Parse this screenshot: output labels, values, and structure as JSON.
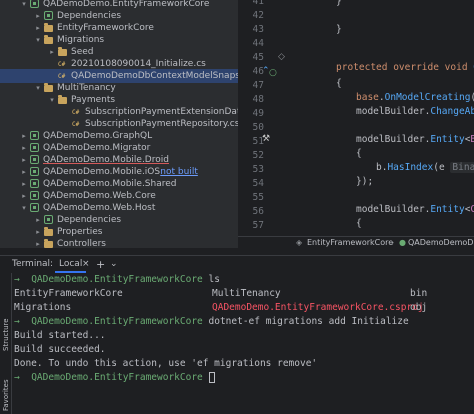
{
  "tree": {
    "rows": [
      {
        "label": "QADemoDemo.EntityFrameworkCore",
        "icon": "project-icon",
        "arrow": "▾",
        "indent": 30,
        "style": ""
      },
      {
        "label": "Dependencies",
        "icon": "project-icon",
        "arrow": "▸",
        "indent": 44,
        "style": ""
      },
      {
        "label": "EntityFrameworkCore",
        "icon": "folder-icon",
        "arrow": "▸",
        "indent": 44,
        "style": ""
      },
      {
        "label": "Migrations",
        "icon": "folder-icon",
        "arrow": "▾",
        "indent": 44,
        "style": ""
      },
      {
        "label": "Seed",
        "icon": "folder-icon",
        "arrow": "▸",
        "indent": 58,
        "style": ""
      },
      {
        "label": "20210108090014_Initialize.cs",
        "icon": "csharp-file-icon",
        "arrow": "",
        "indent": 58,
        "style": ""
      },
      {
        "label": "QADemoDemoDbContextModelSnapshot.c",
        "icon": "csharp-file-icon",
        "arrow": "",
        "indent": 58,
        "style": "sel"
      },
      {
        "label": "MultiTenancy",
        "icon": "folder-icon",
        "arrow": "▾",
        "indent": 44,
        "style": ""
      },
      {
        "label": "Payments",
        "icon": "folder-icon",
        "arrow": "▾",
        "indent": 58,
        "style": ""
      },
      {
        "label": "SubscriptionPaymentExtensionDataRep",
        "icon": "csharp-file-icon",
        "arrow": "",
        "indent": 72,
        "style": ""
      },
      {
        "label": "SubscriptionPaymentRepository.cs",
        "icon": "csharp-file-icon",
        "arrow": "",
        "indent": 72,
        "style": ""
      },
      {
        "label": "QADemoDemo.GraphQL",
        "icon": "project-icon",
        "arrow": "▸",
        "indent": 30,
        "style": ""
      },
      {
        "label": "QADemoDemo.Migrator",
        "icon": "project-icon",
        "arrow": "▸",
        "indent": 30,
        "style": ""
      },
      {
        "label": "QADemoDemo.Mobile.Droid",
        "icon": "project-icon",
        "arrow": "▸",
        "indent": 30,
        "style": "err"
      },
      {
        "label": "QADemoDemo.Mobile.iOS",
        "icon": "project-icon",
        "arrow": "▸",
        "indent": 30,
        "style": "",
        "suffix": "not built"
      },
      {
        "label": "QADemoDemo.Mobile.Shared",
        "icon": "project-icon",
        "arrow": "▸",
        "indent": 30,
        "style": ""
      },
      {
        "label": "QADemoDemo.Web.Core",
        "icon": "project-icon",
        "arrow": "▸",
        "indent": 30,
        "style": ""
      },
      {
        "label": "QADemoDemo.Web.Host",
        "icon": "project-icon",
        "arrow": "▾",
        "indent": 30,
        "style": ""
      },
      {
        "label": "Dependencies",
        "icon": "project-icon",
        "arrow": "▸",
        "indent": 44,
        "style": ""
      },
      {
        "label": "Properties",
        "icon": "folder-icon",
        "arrow": "▸",
        "indent": 44,
        "style": ""
      },
      {
        "label": "Controllers",
        "icon": "folder-icon",
        "arrow": "▸",
        "indent": 44,
        "style": ""
      }
    ]
  },
  "editor": {
    "line_numbers": [
      "41",
      "42",
      "43",
      "44",
      "45",
      "46",
      "47",
      "48",
      "49",
      "50",
      "51",
      "52",
      "53",
      "54",
      "55",
      "56",
      "57"
    ],
    "breadcrumb": {
      "first": "EntityFrameworkCore",
      "second": "QADemoDemoDbContextMod"
    }
  },
  "terminal": {
    "label": "Terminal:",
    "tab": "Local",
    "add": "+",
    "chevron": "⌄",
    "side_labels": [
      "Structure",
      "Favorites"
    ],
    "lines": {
      "l1_prompt": "→",
      "l1_path": "QADemoDemo.EntityFrameworkCore",
      "l1_cmd": "ls",
      "l2a": "EntityFrameworkCore",
      "l2b": "MultiTenancy",
      "l2c": "bin",
      "l3a": "Migrations",
      "l3b": "QADemoDemo.EntityFrameworkCore.csproj",
      "l3c": "obj",
      "l4_prompt": "→",
      "l4_path": "QADemoDemo.EntityFrameworkCore",
      "l4_cmd": "dotnet-ef migrations add Initialize",
      "l5": "Build started...",
      "l6": "Build succeeded.",
      "l7": "Done. To undo this action, use 'ef migrations remove'",
      "l8_prompt": "→",
      "l8_path": "QADemoDemo.EntityFrameworkCore"
    }
  }
}
